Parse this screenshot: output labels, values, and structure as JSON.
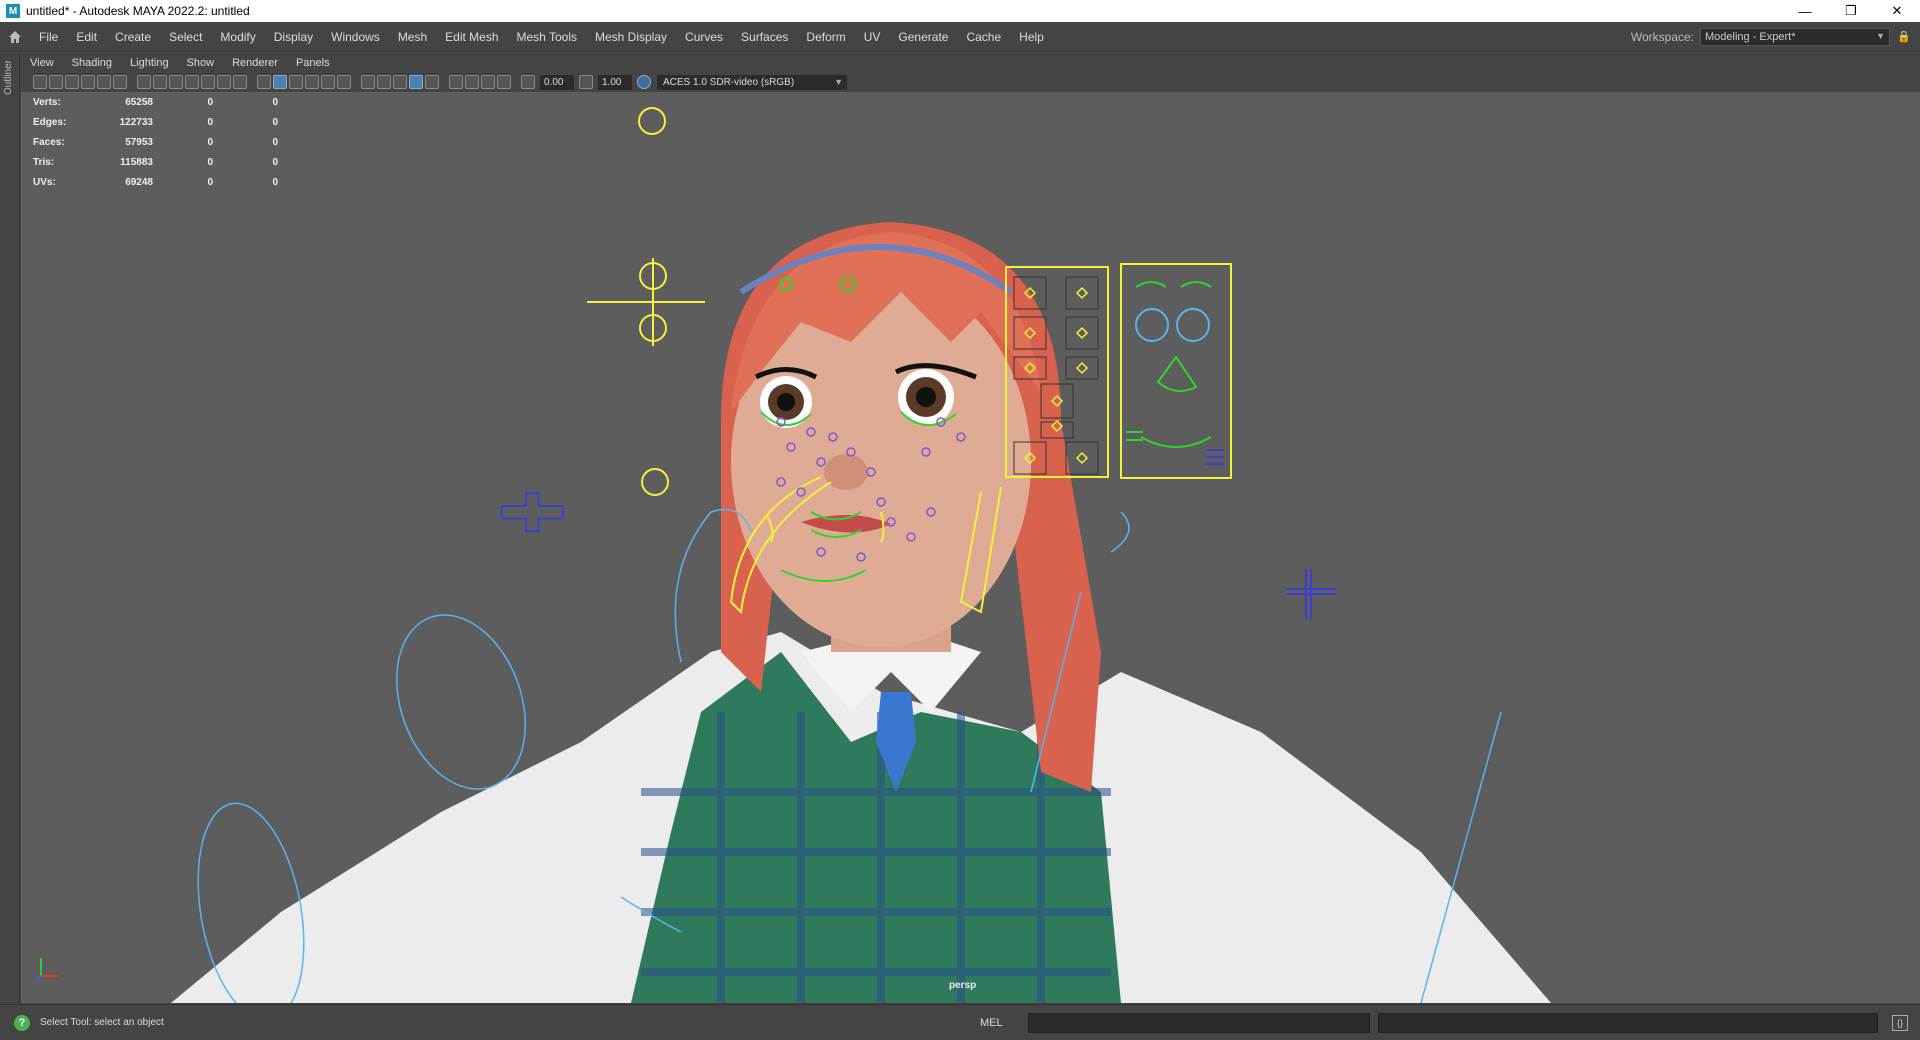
{
  "window": {
    "title": "untitled* - Autodesk MAYA 2022.2: untitled",
    "app_icon": "M",
    "minimize": "—",
    "restore": "❐",
    "close": "✕"
  },
  "menubar": {
    "items": [
      "File",
      "Edit",
      "Create",
      "Select",
      "Modify",
      "Display",
      "Windows",
      "Mesh",
      "Edit Mesh",
      "Mesh Tools",
      "Mesh Display",
      "Curves",
      "Surfaces",
      "Deform",
      "UV",
      "Generate",
      "Cache",
      "Help"
    ],
    "workspace_label": "Workspace:",
    "workspace_value": "Modeling - Expert*"
  },
  "leftstrip": {
    "outliner_label": "Outliner"
  },
  "panel_menu": {
    "items": [
      "View",
      "Shading",
      "Lighting",
      "Show",
      "Renderer",
      "Panels"
    ]
  },
  "panel_toolbar": {
    "exposure": "0.00",
    "gamma": "1.00",
    "color_space": "ACES 1.0 SDR-video (sRGB)"
  },
  "hud": {
    "rows": [
      {
        "label": "Verts:",
        "values": [
          "65258",
          "0",
          "0"
        ]
      },
      {
        "label": "Edges:",
        "values": [
          "122733",
          "0",
          "0"
        ]
      },
      {
        "label": "Faces:",
        "values": [
          "57953",
          "0",
          "0"
        ]
      },
      {
        "label": "Tris:",
        "values": [
          "115883",
          "0",
          "0"
        ]
      },
      {
        "label": "UVs:",
        "values": [
          "69248",
          "0",
          "0"
        ]
      }
    ]
  },
  "viewport": {
    "camera": "persp"
  },
  "statusbar": {
    "message": "Select Tool: select an object",
    "mel_label": "MEL"
  },
  "colors": {
    "viewport_bg": "#5d5d5d",
    "hair": "#d8624e",
    "rig_yellow": "#f2f23a",
    "rig_green": "#2fd42f",
    "rig_blue": "#3b3bd8",
    "rig_cyan": "#5ab4f0"
  }
}
